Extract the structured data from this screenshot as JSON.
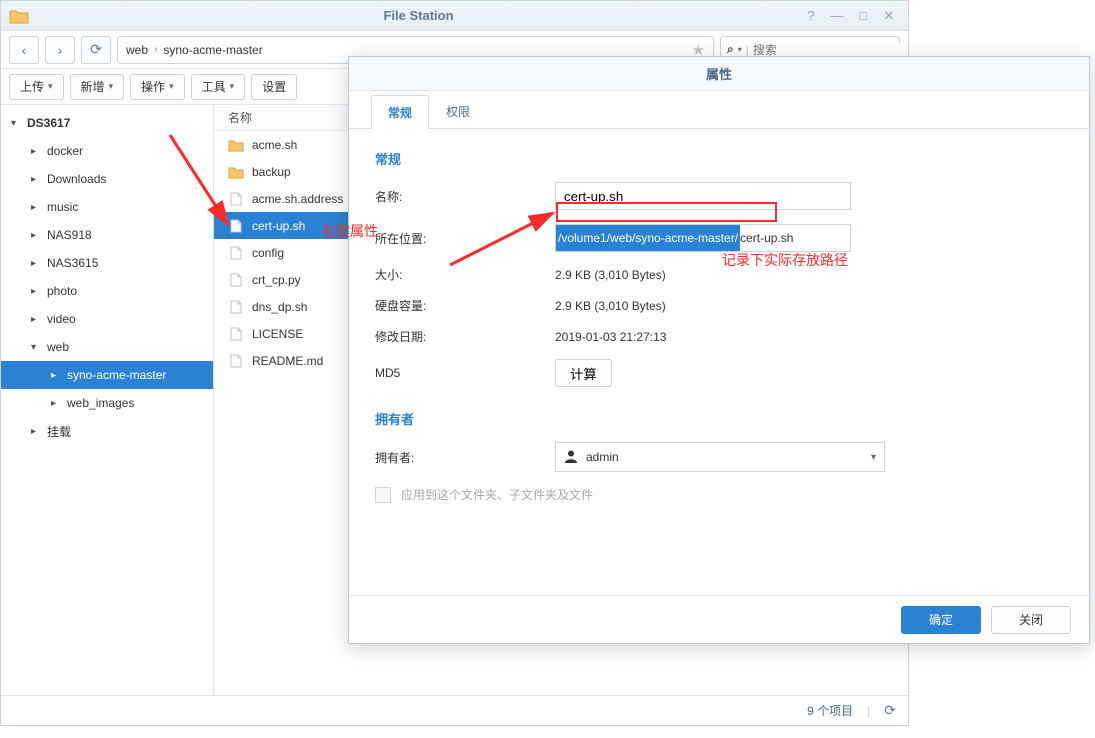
{
  "window": {
    "title": "File Station",
    "controls": {
      "help": "?",
      "min": "—",
      "max": "□",
      "close": "✕"
    }
  },
  "nav": {
    "back": "‹",
    "fwd": "›",
    "reload": "⟳",
    "path": [
      "web",
      "syno-acme-master"
    ]
  },
  "search": {
    "placeholder": "搜索"
  },
  "toolbar": {
    "upload": "上传",
    "create": "新增",
    "action": "操作",
    "tools": "工具",
    "settings": "设置"
  },
  "tree": {
    "root": "DS3617",
    "items": [
      "docker",
      "Downloads",
      "music",
      "NAS918",
      "NAS3615",
      "photo",
      "video"
    ],
    "web": "web",
    "web_children": [
      "syno-acme-master",
      "web_images"
    ],
    "mount": "挂载"
  },
  "filelist": {
    "header": "名称",
    "rows": [
      {
        "name": "acme.sh",
        "type": "folder"
      },
      {
        "name": "backup",
        "type": "folder"
      },
      {
        "name": "acme.sh.address",
        "type": "file"
      },
      {
        "name": "cert-up.sh",
        "type": "file",
        "selected": true
      },
      {
        "name": "config",
        "type": "file"
      },
      {
        "name": "crt_cp.py",
        "type": "file"
      },
      {
        "name": "dns_dp.sh",
        "type": "file"
      },
      {
        "name": "LICENSE",
        "type": "file"
      },
      {
        "name": "README.md",
        "type": "file"
      }
    ]
  },
  "statusbar": {
    "count": "9 个项目"
  },
  "dialog": {
    "title": "属性",
    "tabs": {
      "general": "常规",
      "perm": "权限"
    },
    "general": {
      "section": "常规",
      "name_label": "名称:",
      "name_value": "cert-up.sh",
      "loc_label": "所在位置:",
      "loc_sel": "/volume1/web/syno-acme-master/",
      "loc_rest": "cert-up.sh",
      "size_label": "大小:",
      "size_value": "2.9 KB (3,010 Bytes)",
      "disk_label": "硬盘容量:",
      "disk_value": "2.9 KB (3,010 Bytes)",
      "mtime_label": "修改日期:",
      "mtime_value": "2019-01-03 21:27:13",
      "md5_label": "MD5",
      "md5_btn": "计算"
    },
    "owner": {
      "section": "拥有者",
      "label": "拥有者:",
      "value": "admin",
      "apply": "应用到这个文件夹、子文件夹及文件"
    },
    "buttons": {
      "ok": "确定",
      "cancel": "关闭"
    }
  },
  "annotations": {
    "right_click": "右键属性",
    "record_path": "记录下实际存放路径"
  }
}
